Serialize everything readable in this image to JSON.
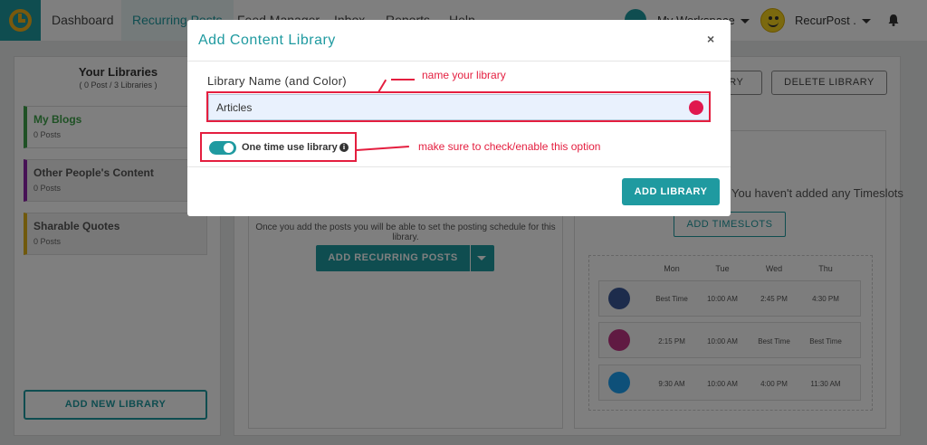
{
  "nav": {
    "items": [
      "Dashboard",
      "Recurring Posts",
      "Feed Manager",
      "Inbox",
      "Reports",
      "Help"
    ],
    "workspace_label": "My Workspace",
    "user_label": "RecurPost ."
  },
  "libraries": {
    "title": "Your Libraries",
    "subtitle": "( 0 Post / 3 Libraries )",
    "items": [
      {
        "name": "My Blogs",
        "count": "0 Posts"
      },
      {
        "name": "Other People's Content",
        "count": "0 Posts"
      },
      {
        "name": "Sharable Quotes",
        "count": "0 Posts"
      }
    ],
    "add_button": "ADD NEW LIBRARY"
  },
  "main": {
    "edit_button": "EDIT LIBRARY",
    "delete_button": "DELETE LIBRARY",
    "posts_hint": "Once you add the posts you will be able to set the posting schedule for this library.",
    "add_posts_button": "ADD RECURRING POSTS",
    "timeslots_text": "You haven't added any Timeslots",
    "add_timeslots_button": "ADD TIMESLOTS",
    "days": [
      "Mon",
      "Tue",
      "Wed",
      "Thu"
    ],
    "schedule_rows": [
      {
        "network": "facebook",
        "color": "#3b5998",
        "cells": [
          "Best Time",
          "10:00 AM",
          "2:45 PM",
          "4:30 PM"
        ]
      },
      {
        "network": "instagram",
        "color": "#c13584",
        "cells": [
          "2:15 PM",
          "10:00 AM",
          "Best Time",
          "Best Time"
        ]
      },
      {
        "network": "twitter",
        "color": "#1da1f2",
        "cells": [
          "9:30 AM",
          "10:00 AM",
          "4:00 PM",
          "11:30 AM"
        ]
      }
    ]
  },
  "modal": {
    "title": "Add Content Library",
    "close": "×",
    "field_label": "Library Name (and Color)",
    "field_value": "Articles",
    "color": "#e0184e",
    "toggle_label": "One time use library",
    "toggle_on": true,
    "submit": "ADD LIBRARY"
  },
  "annotations": {
    "name_hint": "name your library",
    "toggle_hint": "make sure to check/enable this option"
  }
}
